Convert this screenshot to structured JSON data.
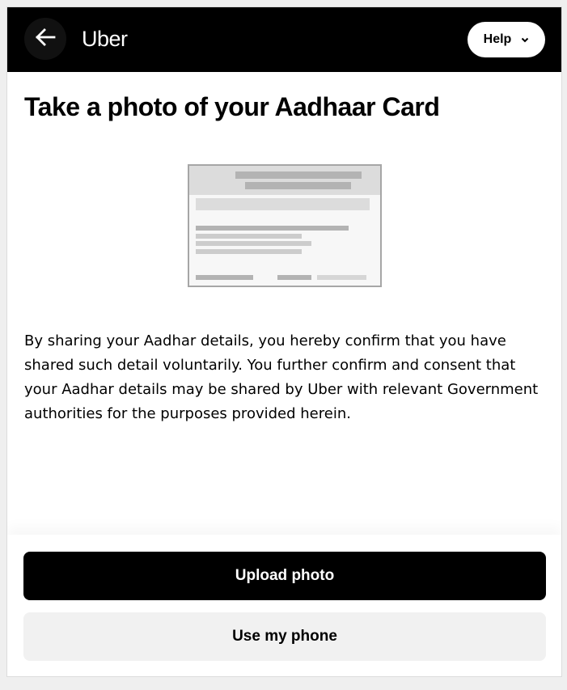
{
  "header": {
    "back_icon": "arrow-left-icon",
    "logo": "Uber",
    "help_label": "Help",
    "help_icon": "chevron-down-icon"
  },
  "main": {
    "title": "Take a photo of your Aadhaar Card",
    "illustration_icon": "id-card-illustration",
    "consent_text": "By sharing your Aadhar details, you hereby confirm that you have shared such detail voluntarily. You further confirm and consent that your Aadhar details may be shared by Uber with relevant Government authorities for the purposes provided herein."
  },
  "actions": {
    "upload_label": "Upload photo",
    "phone_label": "Use my phone"
  },
  "colors": {
    "header_bg": "#000000",
    "primary_button": "#000000",
    "secondary_button": "#f1f1f1"
  }
}
